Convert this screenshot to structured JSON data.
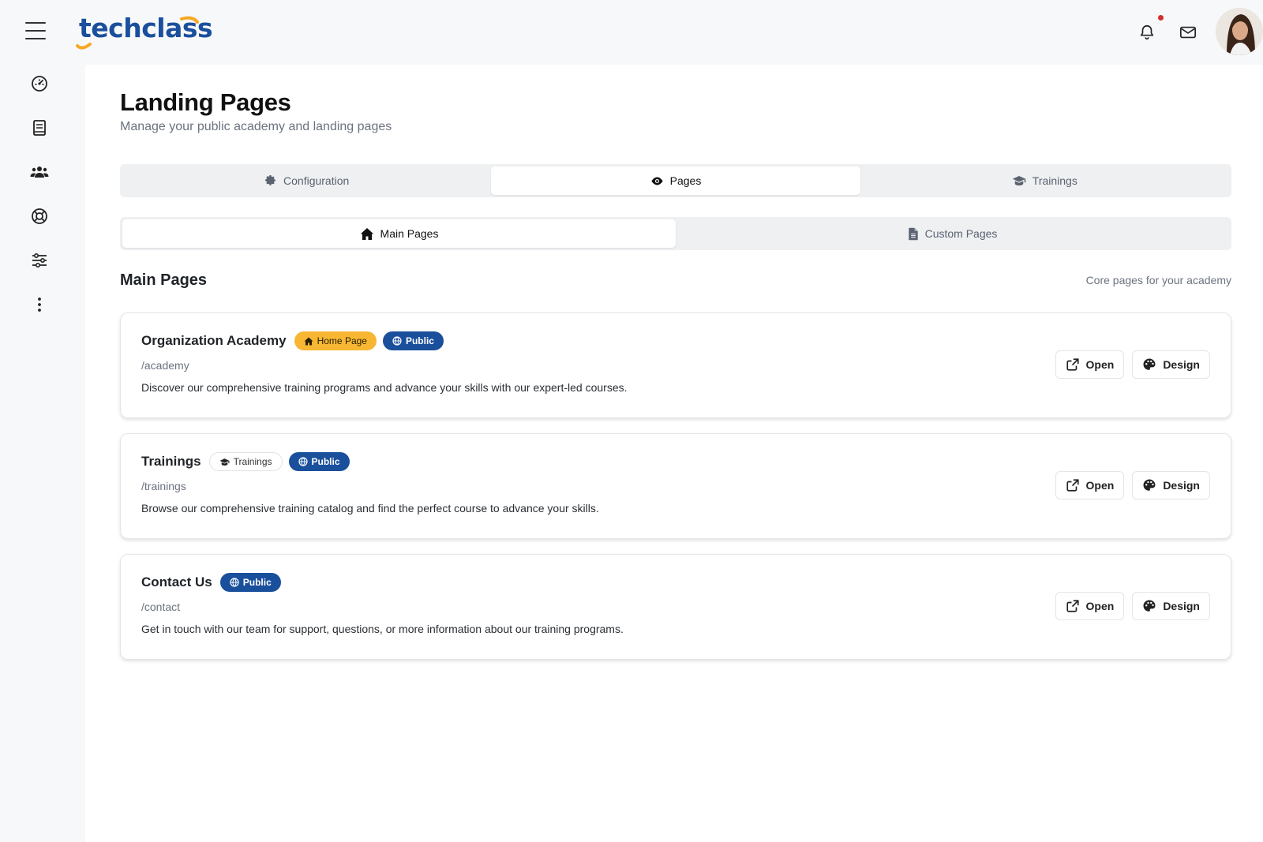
{
  "brand": {
    "logo_text": "techclass",
    "accent": "#f7a823",
    "primary": "#1a4f9c"
  },
  "header": {
    "title": "Landing Pages",
    "subtitle": "Manage your public academy and landing pages"
  },
  "tabs": [
    {
      "label": "Configuration",
      "icon": "gear-icon",
      "active": false
    },
    {
      "label": "Pages",
      "icon": "eye-icon",
      "active": true
    },
    {
      "label": "Trainings",
      "icon": "graduation-cap-icon",
      "active": false
    }
  ],
  "subtabs": [
    {
      "label": "Main Pages",
      "icon": "home-icon",
      "active": true
    },
    {
      "label": "Custom Pages",
      "icon": "file-icon",
      "active": false
    }
  ],
  "section": {
    "title": "Main Pages",
    "note": "Core pages for your academy"
  },
  "pages": [
    {
      "name": "Organization Academy",
      "badges": [
        "Home Page",
        "Public"
      ],
      "path": "/academy",
      "description": "Discover our comprehensive training programs and advance your skills with our expert-led courses."
    },
    {
      "name": "Trainings",
      "badges": [
        "Trainings",
        "Public"
      ],
      "path": "/trainings",
      "description": "Browse our comprehensive training catalog and find the perfect course to advance your skills."
    },
    {
      "name": "Contact Us",
      "badges": [
        "Public"
      ],
      "path": "/contact",
      "description": "Get in touch with our team for support, questions, or more information about our training programs."
    }
  ],
  "actions": {
    "open": "Open",
    "design": "Design"
  }
}
